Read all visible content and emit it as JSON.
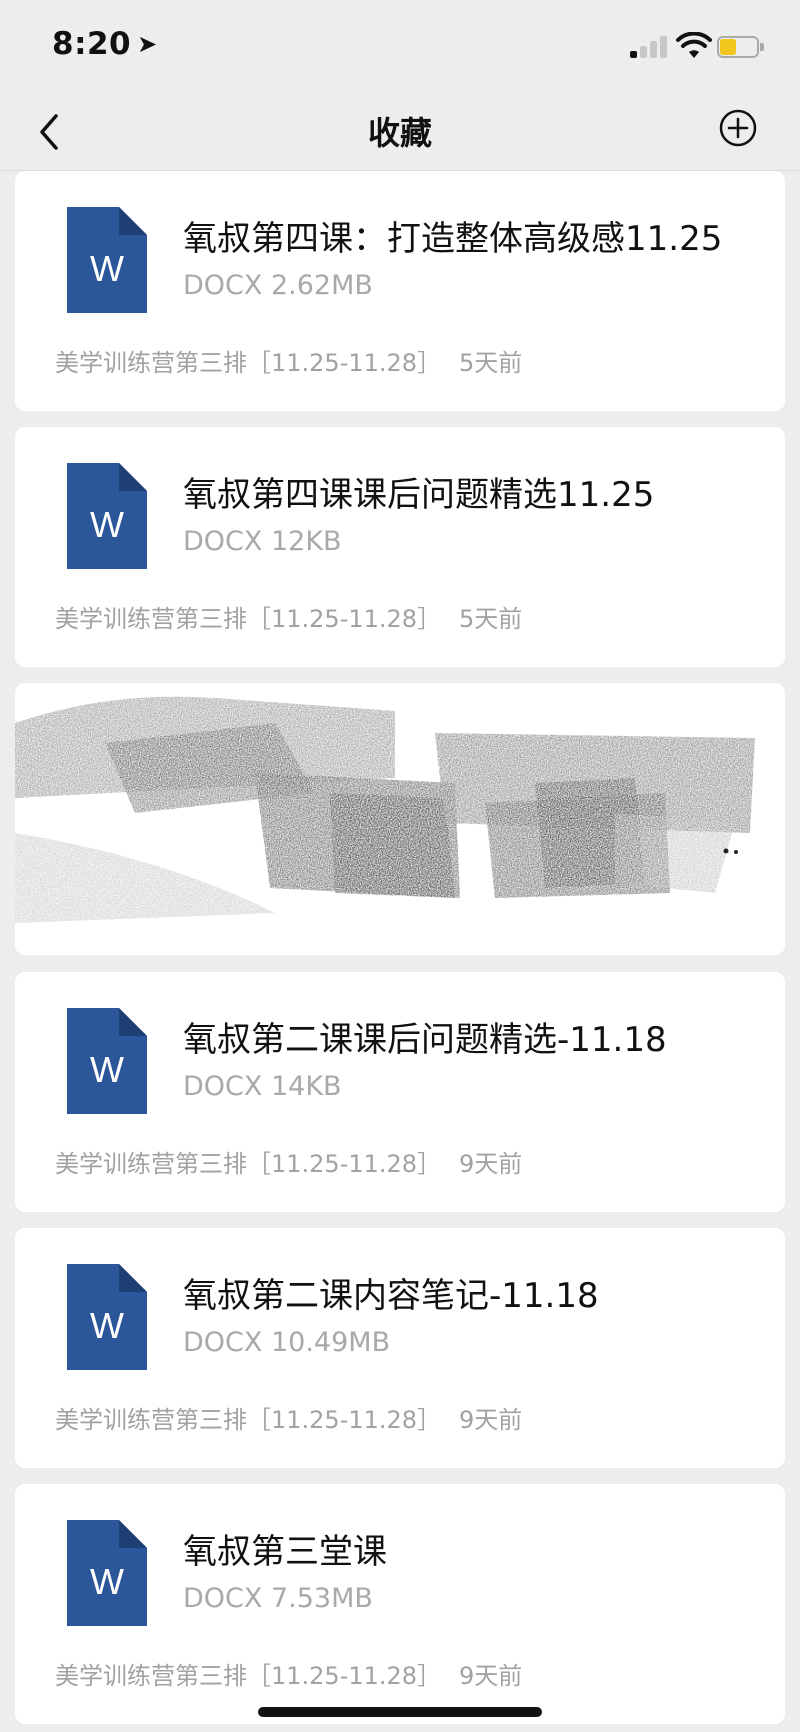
{
  "status": {
    "time": "8:20",
    "location_arrow": "➤"
  },
  "nav": {
    "title": "收藏",
    "back_icon": "chevron-left-icon",
    "add_icon": "plus-circle-icon"
  },
  "items": [
    {
      "title": "氧叔第四课：打造整体高级感11.25",
      "meta": "DOCX 2.62MB",
      "source": "美学训练营第三排［11.25-11.28］",
      "time": "5天前"
    },
    {
      "title": "氧叔第四课课后问题精选11.25",
      "meta": "DOCX 12KB",
      "source": "美学训练营第三排［11.25-11.28］",
      "time": "5天前"
    },
    {
      "title": "氧叔第二课课后问题精选-11.18",
      "meta": "DOCX 14KB",
      "source": "美学训练营第三排［11.25-11.28］",
      "time": "9天前"
    },
    {
      "title": "氧叔第二课内容笔记-11.18",
      "meta": "DOCX 10.49MB",
      "source": "美学训练营第三排［11.25-11.28］",
      "time": "9天前"
    },
    {
      "title": "氧叔第三堂课",
      "meta": "DOCX 7.53MB",
      "source": "美学训练营第三排［11.25-11.28］",
      "time": "9天前"
    }
  ],
  "colors": {
    "word_blue": "#2b579a",
    "battery_yellow": "#f2c61d"
  }
}
